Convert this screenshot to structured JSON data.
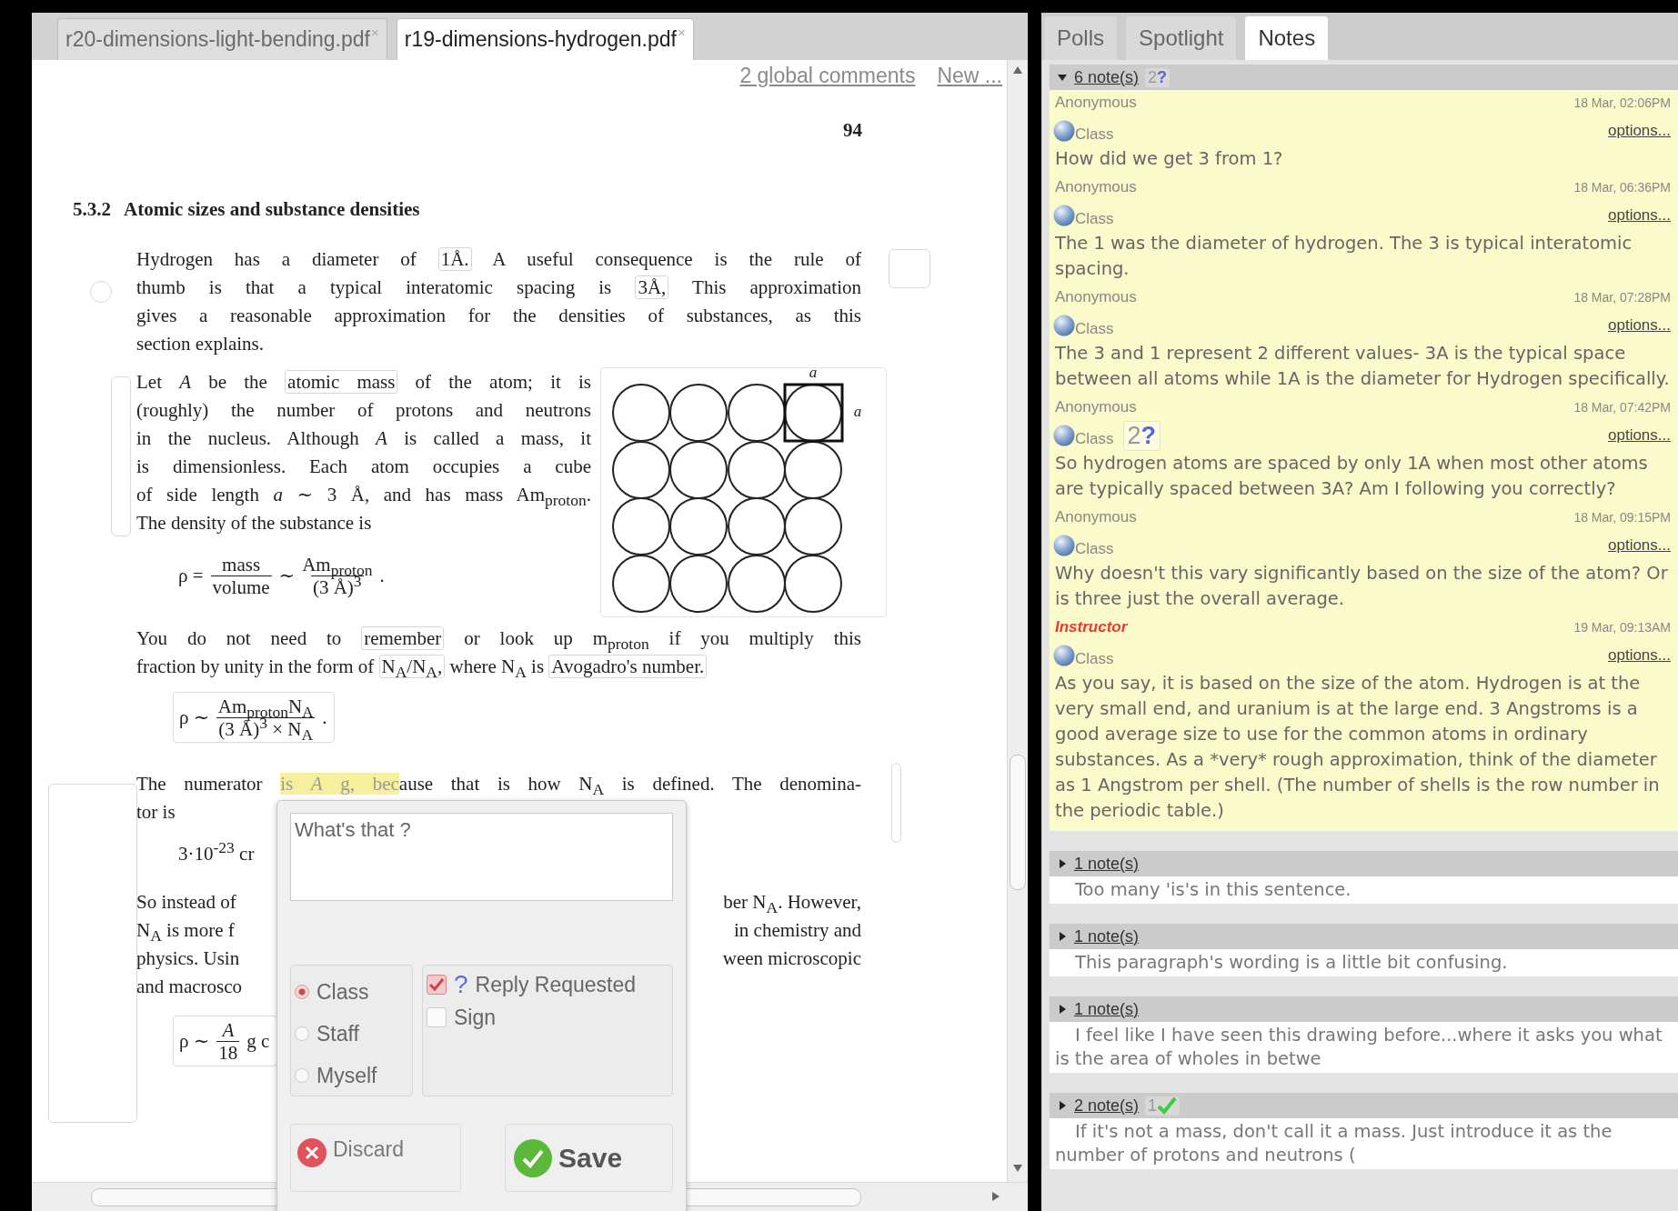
{
  "doc_tabs": [
    {
      "label": "r20-dimensions-light-bending.pdf",
      "close": "×",
      "selected": false
    },
    {
      "label": "r19-dimensions-hydrogen.pdf",
      "close": "×",
      "selected": true
    }
  ],
  "doc_links": [
    "2 global comments",
    "New ..."
  ],
  "document": {
    "page_number": "94",
    "heading": {
      "number": "5.3.2",
      "title": "Atomic sizes and substance densities"
    },
    "blocks": [
      {
        "kind": "para",
        "lines": [
          [
            "Hydrogen has a diameter of ",
            {
              "text": "1Å.",
              "boxed": true
            },
            " A useful consequence is the rule of"
          ],
          [
            "thumb is that a typical interatomic spacing is ",
            {
              "text": "3Å,",
              "boxed": true
            },
            " This approximation"
          ],
          "gives a reasonable approximation for the densities of substances, as this",
          "section explains."
        ]
      },
      {
        "kind": "figure_row",
        "blocks": [
          {
            "kind": "para",
            "lines": [
              [
                "Let *A* be the ",
                {
                  "text": "atomic mass",
                  "boxed": true
                },
                " of the atom; it is"
              ],
              "(roughly) the number of protons and neutrons",
              "in the nucleus. Although *A* is called a mass, it",
              "is dimensionless. Each atom occupies a cube",
              "of side length *a* ∼ 3 Å, and has mass Am$_{proton}$.",
              "The density of the substance is"
            ]
          },
          {
            "kind": "formula",
            "boxed": false,
            "parts": [
              {
                "kind": "text",
                "text": "ρ ="
              },
              {
                "kind": "frac",
                "num": "mass",
                "den": "volume"
              },
              {
                "kind": "text",
                "text": "∼"
              },
              {
                "kind": "frac",
                "num": "Am$_{proton}$",
                "den": "(3 Å)$^{3}$"
              },
              {
                "kind": "text",
                "text": "."
              }
            ]
          }
        ],
        "figure": {
          "labels": [
            "a",
            "a"
          ]
        }
      },
      {
        "kind": "para",
        "lines": [
          [
            "You do not need to ",
            {
              "text": "remember",
              "boxed": true
            },
            " or look up m$_{proton}$ if you multiply this"
          ],
          [
            "fraction by unity in the form of ",
            {
              "text": "N$_{A}$/N$_{A}$,",
              "boxed": true
            },
            " where N$_{A}$ is ",
            {
              "text": "Avogadro's number.",
              "boxed": true
            }
          ]
        ]
      },
      {
        "kind": "formula",
        "boxed": true,
        "parts": [
          {
            "kind": "text",
            "text": "ρ ∼"
          },
          {
            "kind": "frac",
            "num": "Am$_{proton}$N$_{A}$",
            "den": "(3 Å)$^{3}$ × N$_{A}$"
          },
          {
            "kind": "text",
            "text": "."
          }
        ]
      },
      {
        "kind": "para",
        "lines": [
          [
            "The numerator ",
            {
              "text": "is *A* g, bec",
              "highlighted": true
            },
            "ause that is how N$_{A}$ is defined. The denomina-"
          ],
          "tor is"
        ]
      },
      {
        "kind": "formula",
        "boxed": false,
        "parts": [
          {
            "kind": "text",
            "text": "3·10$^{-23}$ cr"
          }
        ]
      },
      {
        "kind": "split_para",
        "lines": [
          {
            "left": "So instead of",
            "right": "ber N$_{A}$. However,"
          },
          {
            "left": "N$_{A}$ is more f",
            "right": "in chemistry and"
          },
          {
            "left": "physics. Usin",
            "right": "ween microscopic"
          },
          {
            "left": "and macrosco"
          }
        ]
      },
      {
        "kind": "formula",
        "boxed": true,
        "parts": [
          {
            "kind": "text",
            "text": "ρ ∼"
          },
          {
            "kind": "frac",
            "num": "*A*",
            "den": "18"
          },
          {
            "kind": "text",
            "text": "g c"
          }
        ]
      }
    ]
  },
  "note_editor": {
    "value": "What's that ?",
    "audiences": [
      {
        "label": "Class",
        "selected": true
      },
      {
        "label": "Staff",
        "selected": false
      },
      {
        "label": "Myself",
        "selected": false
      }
    ],
    "options": [
      {
        "label": "Reply Requested",
        "symbol": "?",
        "checked": true
      },
      {
        "label": "Sign",
        "checked": false
      }
    ],
    "buttons": [
      {
        "label": "Discard",
        "kind": "discard"
      },
      {
        "label": "Save",
        "kind": "save"
      }
    ]
  },
  "side_tabs": [
    {
      "label": "Polls",
      "selected": false
    },
    {
      "label": "Spotlight",
      "selected": false
    },
    {
      "label": "Notes",
      "selected": true
    }
  ],
  "threads": [
    {
      "count_label": "6 note(s)",
      "expanded": true,
      "badge": {
        "count": "2",
        "symbol": "?",
        "kind": "question"
      },
      "notes": [
        {
          "author": "Anonymous",
          "instructor": false,
          "date": "18 Mar, 02:06PM",
          "audience": "Class",
          "options": "options...",
          "text": "How did we get 3 from 1?"
        },
        {
          "author": "Anonymous",
          "instructor": false,
          "date": "18 Mar, 06:36PM",
          "audience": "Class",
          "options": "options...",
          "text": "The 1 was the diameter of hydrogen. The 3 is typical interatomic spacing."
        },
        {
          "author": "Anonymous",
          "instructor": false,
          "date": "18 Mar, 07:28PM",
          "audience": "Class",
          "options": "options...",
          "text": "The 3 and 1 represent 2 different values- 3A is the typical space between all atoms while 1A is the diameter for Hydrogen specifically."
        },
        {
          "author": "Anonymous",
          "instructor": false,
          "date": "18 Mar, 07:42PM",
          "audience": "Class",
          "badge": {
            "count": "2",
            "symbol": "?",
            "kind": "question"
          },
          "options": "options...",
          "text": "So hydrogen atoms are spaced by only 1A when most other atoms are typically spaced between 3A? Am I following you correctly?"
        },
        {
          "author": "Anonymous",
          "instructor": false,
          "date": "18 Mar, 09:15PM",
          "audience": "Class",
          "options": "options...",
          "text": "Why doesn't this vary significantly based on the size of the atom? Or is three just the overall average."
        },
        {
          "author": "Instructor",
          "instructor": true,
          "date": "19 Mar, 09:13AM",
          "audience": "Class",
          "options": "options...",
          "text": "As you say, it is based on the size of the atom. Hydrogen is at the very small end, and uranium is at the large end. 3 Angstroms is a good average size to use for the common atoms in ordinary substances. As a *very* rough approximation, think of the diameter as 1 Angstrom per shell. (The number of shells is the row number in the periodic table.)"
        }
      ]
    },
    {
      "count_label": "1 note(s)",
      "expanded": false,
      "preview": "Too many 'is's in this sentence."
    },
    {
      "count_label": "1 note(s)",
      "expanded": false,
      "preview": "This paragraph's wording is a little bit confusing."
    },
    {
      "count_label": "1 note(s)",
      "expanded": false,
      "preview": "I feel like I have seen this drawing before...where it asks you what is the area of wholes in betwe"
    },
    {
      "count_label": "2 note(s)",
      "expanded": false,
      "badge": {
        "count": "1",
        "kind": "resolved"
      },
      "preview": "If it's not a mass, don't call it a mass. Just introduce it as the number of protons and neutrons ("
    }
  ]
}
